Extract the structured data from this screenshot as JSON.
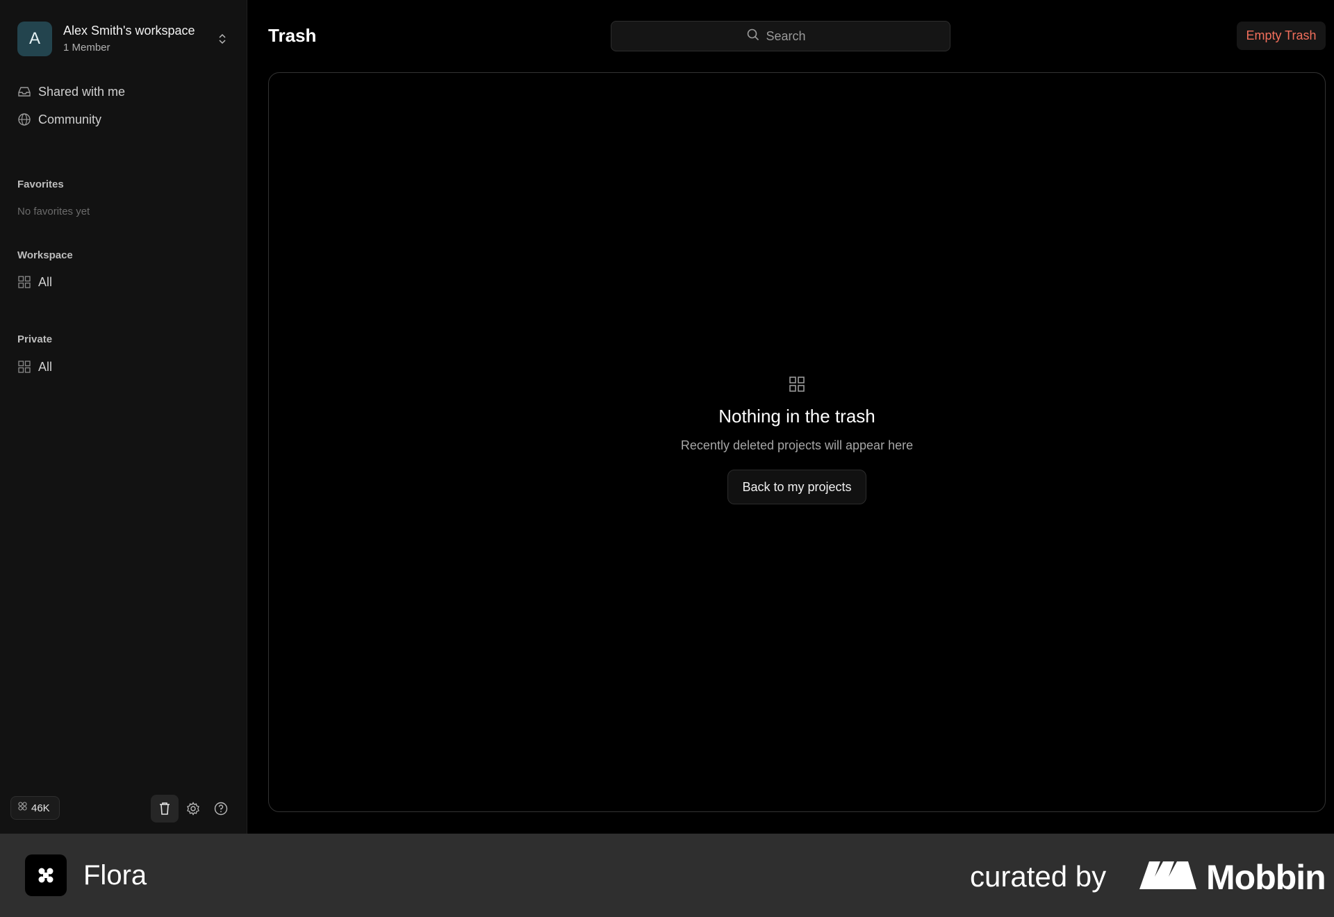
{
  "workspace": {
    "initial": "A",
    "name": "Alex Smith's workspace",
    "members": "1 Member"
  },
  "sidebar": {
    "nav": [
      {
        "label": "Shared with me",
        "icon": "inbox-icon"
      },
      {
        "label": "Community",
        "icon": "globe-icon"
      }
    ],
    "favorites": {
      "title": "Favorites",
      "empty": "No favorites yet"
    },
    "workspace_section": {
      "title": "Workspace",
      "item": "All"
    },
    "private_section": {
      "title": "Private",
      "item": "All"
    },
    "credits": "46K"
  },
  "header": {
    "title": "Trash",
    "search_placeholder": "Search",
    "empty_trash_label": "Empty Trash"
  },
  "empty_state": {
    "title": "Nothing in the trash",
    "subtitle": "Recently deleted projects will appear here",
    "button_label": "Back to my projects"
  },
  "footer": {
    "brand": "Flora",
    "curated_by": "curated by",
    "curator": "Mobbin"
  },
  "colors": {
    "accent_danger": "#f26f5c",
    "avatar_bg": "#23444e",
    "footer_bg": "#2f2f2f"
  }
}
